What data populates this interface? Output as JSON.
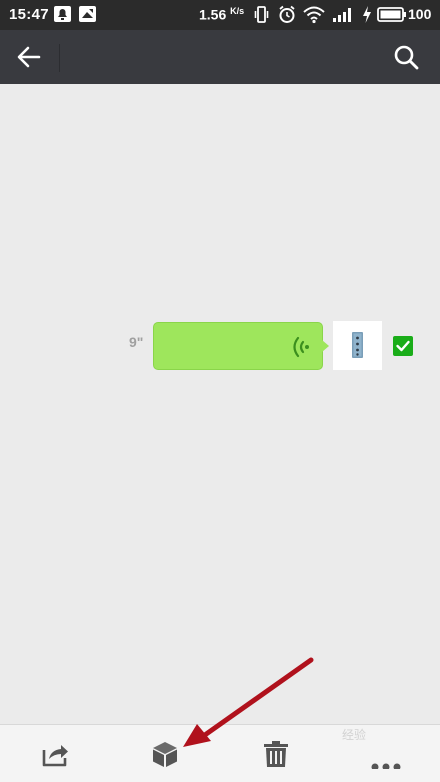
{
  "status_bar": {
    "time": "15:47",
    "speed_value": "1.56",
    "speed_unit": "K/s",
    "battery_percent": "100"
  },
  "app_bar": {
    "title": "",
    "back_icon": "arrow-left",
    "search_icon": "magnifier"
  },
  "conversation": {
    "messages": [
      {
        "type": "voice",
        "duration": "9\"",
        "selected": true
      }
    ]
  },
  "bottom_bar": {
    "actions": [
      "share",
      "favorite",
      "delete",
      "more"
    ]
  },
  "annotation": {
    "arrow_color": "#b0111c"
  },
  "watermark": "经验",
  "colors": {
    "status_bar_bg": "#2b2b2b",
    "app_bar_bg": "#393a3f",
    "chat_bg": "#ebebeb",
    "voice_bubble": "#9ee65c",
    "check_green": "#1aad19"
  }
}
